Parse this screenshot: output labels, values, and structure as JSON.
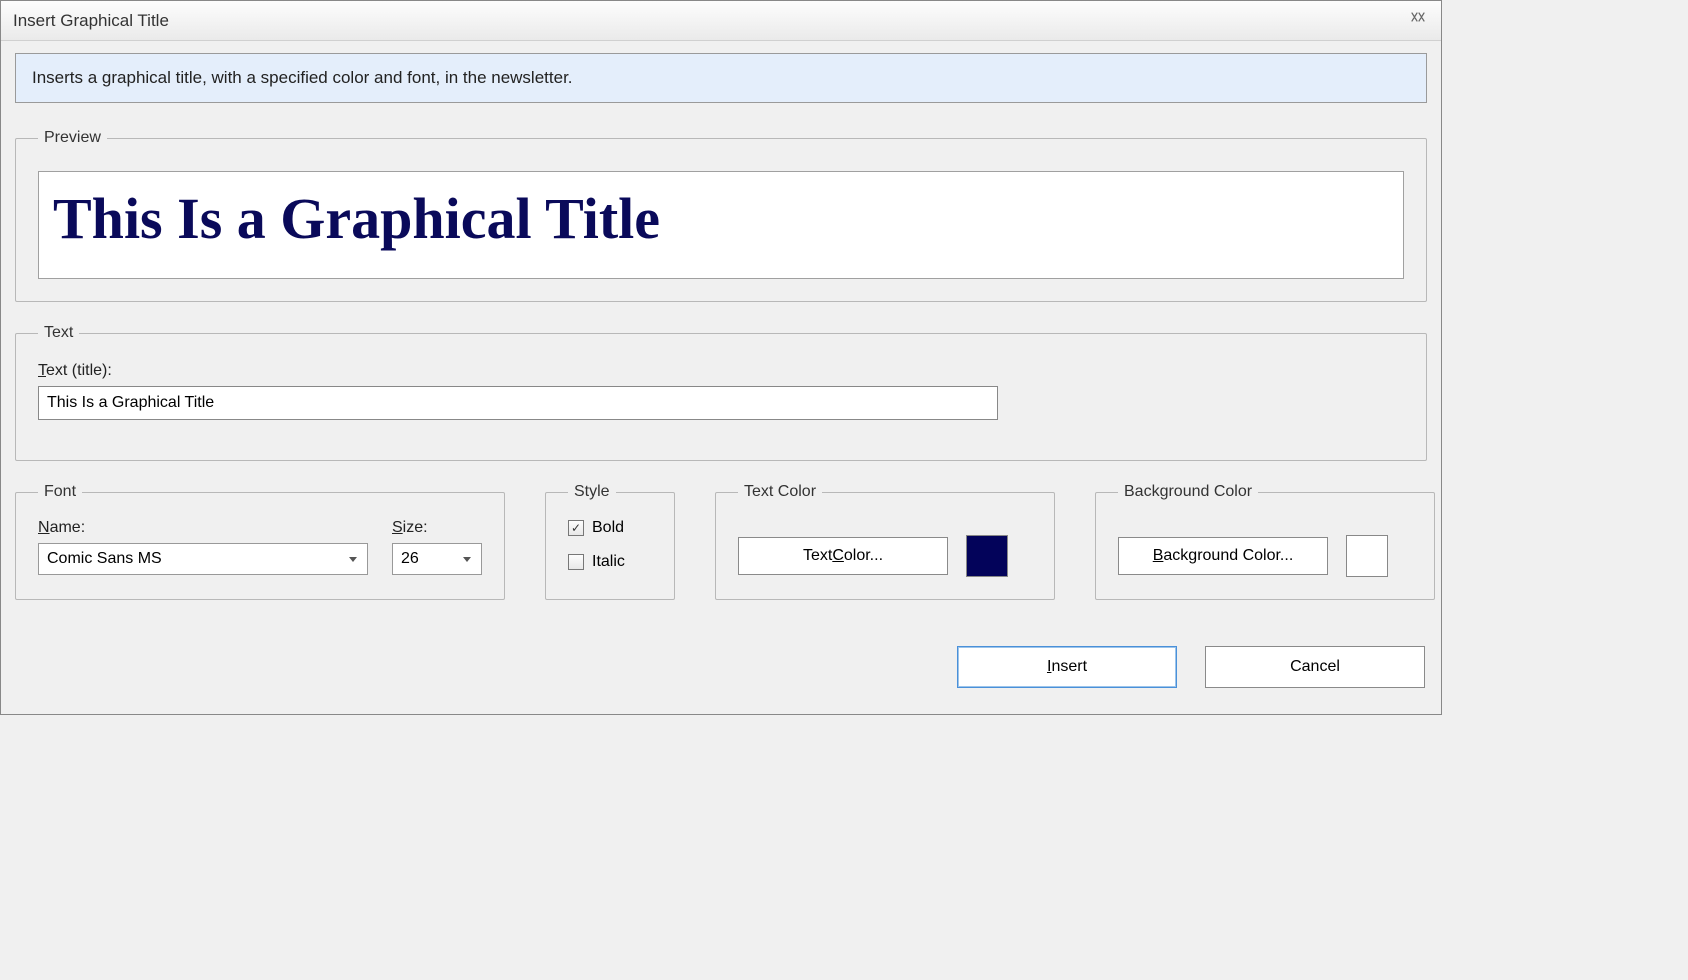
{
  "window": {
    "title": "Insert Graphical Title"
  },
  "banner": {
    "text": "Inserts a graphical title, with a specified color and font, in the newsletter."
  },
  "preview": {
    "legend": "Preview",
    "text": "This Is a Graphical Title",
    "font_family": "Comic Sans MS",
    "bold": true,
    "color": "#0a0a5a"
  },
  "text": {
    "legend": "Text",
    "label_pre": "T",
    "label_post": "ext (title):",
    "value": "This Is a Graphical Title"
  },
  "font": {
    "legend": "Font",
    "name_label_pre": "N",
    "name_label_post": "ame:",
    "name_value": "Comic Sans MS",
    "size_label_pre": "S",
    "size_label_post": "ize:",
    "size_value": "26"
  },
  "style": {
    "legend": "Style",
    "bold_label": "Bold",
    "bold_checked": true,
    "italic_label": "Italic",
    "italic_checked": false
  },
  "text_color": {
    "legend": "Text Color",
    "button_pre": "Text ",
    "button_ul": "C",
    "button_post": "olor...",
    "swatch": "#03035a"
  },
  "bg_color": {
    "legend": "Background Color",
    "button_pre": "B",
    "button_mid": "ackground Color...",
    "swatch": "#ffffff"
  },
  "footer": {
    "insert_pre": "I",
    "insert_post": "nsert",
    "cancel": "Cancel"
  }
}
